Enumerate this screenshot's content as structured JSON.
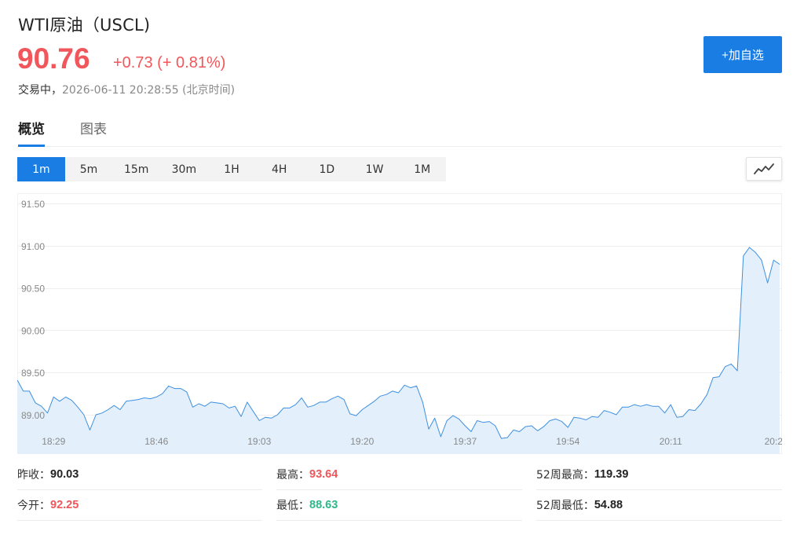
{
  "header": {
    "title": "WTI原油（USCL)",
    "price": "90.76",
    "change": "+0.73 (+ 0.81%)",
    "status_label": "交易中，",
    "timestamp": "2026-06-11 20:28:55 (北京时间)",
    "add_watchlist_label": "+加自选"
  },
  "tabs": [
    {
      "label": "概览",
      "active": true
    },
    {
      "label": "图表",
      "active": false
    }
  ],
  "periods": [
    {
      "label": "1m",
      "active": true
    },
    {
      "label": "5m"
    },
    {
      "label": "15m"
    },
    {
      "label": "30m"
    },
    {
      "label": "1H"
    },
    {
      "label": "4H"
    },
    {
      "label": "1D"
    },
    {
      "label": "1W"
    },
    {
      "label": "1M"
    }
  ],
  "chart_toggle_icon": "line-chart-icon",
  "colors": {
    "up": "#f0565a",
    "down": "#2eb88a",
    "accent": "#1a7de3",
    "line": "#3d8fe0",
    "fill": "#e3f0fc"
  },
  "chart_data": {
    "type": "area",
    "ylim": [
      88.85,
      91.55
    ],
    "yticks": [
      "91.50",
      "91.00",
      "90.50",
      "90.00",
      "89.50",
      "89.00"
    ],
    "ytick_values": [
      91.5,
      91.0,
      90.5,
      90.0,
      89.5,
      89.0
    ],
    "xticks": [
      "18:29",
      "18:46",
      "19:03",
      "19:20",
      "19:37",
      "19:54",
      "20:11",
      "20:2"
    ],
    "xtick_index": [
      6,
      23,
      40,
      57,
      74,
      91,
      108,
      125
    ],
    "grid": true,
    "values": [
      89.41,
      89.28,
      89.28,
      89.14,
      89.1,
      89.02,
      89.21,
      89.16,
      89.21,
      89.17,
      89.09,
      89.0,
      88.82,
      89.0,
      89.02,
      89.06,
      89.11,
      89.06,
      89.16,
      89.17,
      89.18,
      89.2,
      89.19,
      89.21,
      89.25,
      89.34,
      89.31,
      89.31,
      89.27,
      89.09,
      89.13,
      89.1,
      89.15,
      89.14,
      89.13,
      89.08,
      89.1,
      88.98,
      89.15,
      89.04,
      88.93,
      88.97,
      88.96,
      89.0,
      89.08,
      89.08,
      89.12,
      89.2,
      89.09,
      89.11,
      89.15,
      89.15,
      89.19,
      89.22,
      89.18,
      89.01,
      88.99,
      89.06,
      89.11,
      89.16,
      89.22,
      89.24,
      89.28,
      89.26,
      89.35,
      89.32,
      89.34,
      89.15,
      88.83,
      88.96,
      88.74,
      88.93,
      88.99,
      88.95,
      88.87,
      88.8,
      88.93,
      88.91,
      88.92,
      88.87,
      88.72,
      88.73,
      88.82,
      88.8,
      88.86,
      88.87,
      88.81,
      88.86,
      88.93,
      88.95,
      88.92,
      88.85,
      88.97,
      88.96,
      88.94,
      88.98,
      88.97,
      89.05,
      89.03,
      89.0,
      89.09,
      89.09,
      89.12,
      89.1,
      89.12,
      89.1,
      89.1,
      89.02,
      89.12,
      88.97,
      88.98,
      89.06,
      89.05,
      89.13,
      89.24,
      89.44,
      89.45,
      89.57,
      89.6,
      89.52,
      90.88,
      90.98,
      90.92,
      90.83,
      90.56,
      90.83,
      90.78
    ]
  },
  "stats": {
    "prev_close_label": "昨收：",
    "prev_close": "90.03",
    "open_label": "今开：",
    "open": "92.25",
    "high_label": "最高：",
    "high": "93.64",
    "low_label": "最低：",
    "low": "88.63",
    "w52_high_label": "52周最高：",
    "w52_high": "119.39",
    "w52_low_label": "52周最低：",
    "w52_low": "54.88"
  }
}
